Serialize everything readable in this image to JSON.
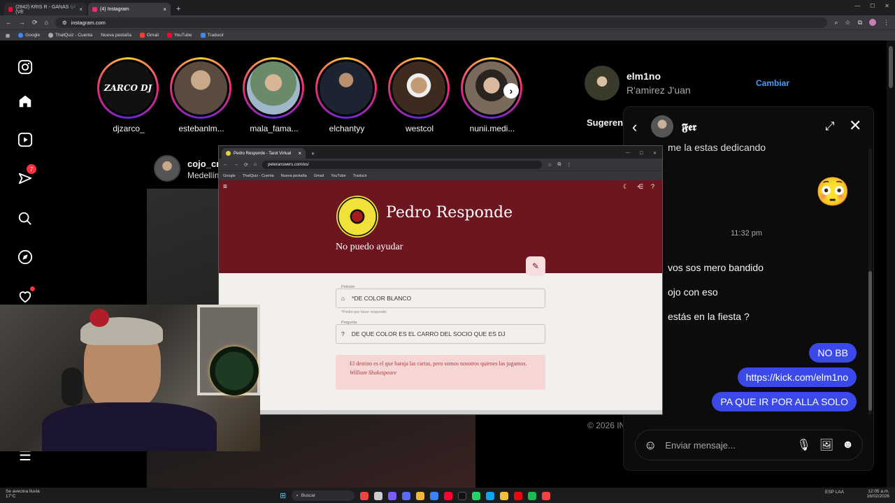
{
  "browser": {
    "tabs": [
      {
        "label": "(2842) KRIS R - GANAS 🎶 (VE",
        "color": "#ff0033"
      },
      {
        "label": "(4) Instagram",
        "color": "#e1306c"
      }
    ],
    "url": "instagram.com",
    "bookmarks": [
      "Google",
      "ThatQuiz - Cuenta",
      "Nueva pestaña",
      "Gmail",
      "YouTube",
      "Traducir"
    ]
  },
  "instagram": {
    "notif_count": "7",
    "stories": [
      {
        "name": "djzarco_",
        "logo_text": "ZARCO DJ",
        "color": "#222"
      },
      {
        "name": "estebanlm...",
        "color": "#5a4b3e"
      },
      {
        "name": "mala_fama...",
        "color": "#6b8a6a"
      },
      {
        "name": "elchantyy",
        "color": "#1b2430"
      },
      {
        "name": "westcol",
        "color": "#3c2b1e"
      },
      {
        "name": "nunii.medi...",
        "color": "#7a6a5c"
      }
    ],
    "profile": {
      "username": "elm1no",
      "full_name": "R'amirez J'uan",
      "switch_label": "Cambiar"
    },
    "suggestions_label": "Sugeren",
    "suggested_user": {
      "name": "cojo_cr",
      "location": "Medellín"
    },
    "footer": "© 2026 IN"
  },
  "pedro_window": {
    "tab_label": "Pedro Responde - Tarot Virtual",
    "url": "peteranswers.com/es/",
    "bookmarks": [
      "Google",
      "ThatQuiz - Cuenta",
      "Nueva pestaña",
      "Gmail",
      "YouTube",
      "Traducir"
    ],
    "title": "Pedro Responde",
    "subtitle": "No puedo ayudar",
    "peticion_label": "Petición",
    "peticion_value": "*DE COLOR BLANCO",
    "peticion_hint": "*Pedro por favor responde",
    "pregunta_label": "Pregunta",
    "pregunta_value": "DE QUE COLOR ES EL CARRO DEL SOCIO QUE ES DJ",
    "quote": "El destino es el que baraja las cartas, pero somos nosotros quienes las jugamos.",
    "quote_author": "William Shakespeare"
  },
  "dm": {
    "contact": "𝕱𝖊𝖗",
    "partial_msg": "me la estas dedicando",
    "timestamp": "11:32 pm",
    "incoming": [
      "vos sos mero bandido",
      "ojo con eso",
      "estás en la fiesta ?"
    ],
    "outgoing": [
      "NO BB",
      "https://kick.com/elm1no",
      "PA QUE IR POR ALLA SOLO"
    ],
    "input_placeholder": "Enviar mensaje...",
    "emoji": "😳"
  },
  "taskbar": {
    "weather": "Se avecina lluvia",
    "weather_temp": "17°C",
    "search": "Buscar",
    "lang": "ESP LAA",
    "time": "12:05 a.m.",
    "date": "16/02/2026"
  }
}
